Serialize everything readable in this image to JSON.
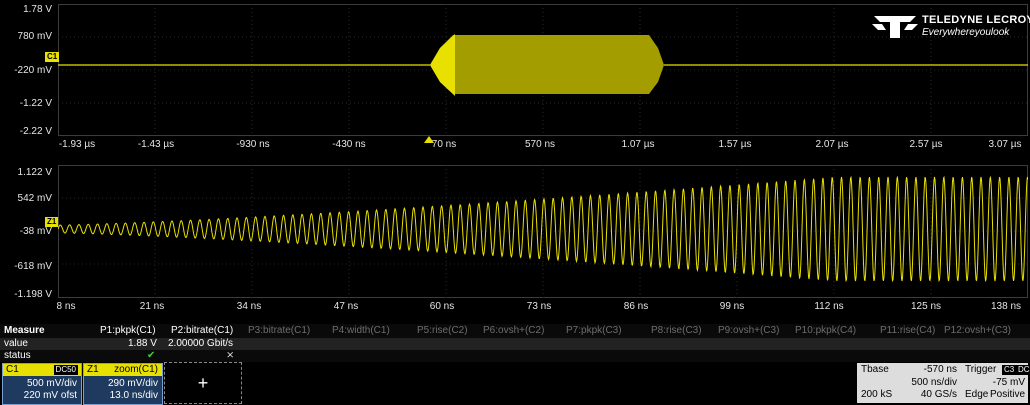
{
  "top_panel": {
    "y_labels": [
      "1.78 V",
      "780 mV",
      "-220 mV",
      "-1.22 V",
      "-2.22 V"
    ],
    "x_labels": [
      "-1.93 µs",
      "-1.43 µs",
      "-930 ns",
      "-430 ns",
      "70 ns",
      "570 ns",
      "1.07 µs",
      "1.57 µs",
      "2.07 µs",
      "2.57 µs",
      "3.07 µs"
    ],
    "channel_tag": "C1",
    "trace_color": "#e8e000"
  },
  "bottom_panel": {
    "y_labels": [
      "1.122 V",
      "542 mV",
      "-38 mV",
      "-618 mV",
      "-1.198 V"
    ],
    "x_labels": [
      "8 ns",
      "21 ns",
      "34 ns",
      "47 ns",
      "60 ns",
      "73 ns",
      "86 ns",
      "99 ns",
      "112 ns",
      "125 ns",
      "138 ns"
    ],
    "channel_tag": "Z1",
    "trace_color": "#e8e000"
  },
  "logo": {
    "name": "TELEDYNE LECROY",
    "tagline": "Everywhereyoulook"
  },
  "measure": {
    "title": "Measure",
    "row_labels": [
      "value",
      "status"
    ],
    "params": [
      {
        "name": "P1:pkpk(C1)",
        "value": "1.88 V",
        "status": "✔",
        "active": true
      },
      {
        "name": "P2:bitrate(C1)",
        "value": "2.00000 Gbit/s",
        "status": "⨯",
        "active": true
      },
      {
        "name": "P3:bitrate(C1)",
        "value": "",
        "status": "",
        "active": false
      },
      {
        "name": "P4:width(C1)",
        "value": "",
        "status": "",
        "active": false
      },
      {
        "name": "P5:rise(C2)",
        "value": "",
        "status": "",
        "active": false
      },
      {
        "name": "P6:ovsh+(C2)",
        "value": "",
        "status": "",
        "active": false
      },
      {
        "name": "P7:pkpk(C3)",
        "value": "",
        "status": "",
        "active": false
      },
      {
        "name": "P8:rise(C3)",
        "value": "",
        "status": "",
        "active": false
      },
      {
        "name": "P9:ovsh+(C3)",
        "value": "",
        "status": "",
        "active": false
      },
      {
        "name": "P10:pkpk(C4)",
        "value": "",
        "status": "",
        "active": false
      },
      {
        "name": "P11:rise(C4)",
        "value": "",
        "status": "",
        "active": false
      },
      {
        "name": "P12:ovsh+(C3)",
        "value": "",
        "status": "",
        "active": false
      }
    ]
  },
  "c1_desc": {
    "label": "C1",
    "badge": "DC50",
    "line1": "500 mV/div",
    "line2": "220 mV ofst"
  },
  "z1_desc": {
    "label": "Z1",
    "title": "zoom(C1)",
    "line1": "290 mV/div",
    "line2": "13.0 ns/div"
  },
  "add_button": {
    "label": "+"
  },
  "timebase": {
    "tbase_label": "Tbase",
    "tbase_value": "-570 ns",
    "trigger_label": "Trigger",
    "trigger_badge1": "C3",
    "trigger_badge2": "DC",
    "line2_left": "500 ns/div",
    "line2_right": "-75 mV",
    "line3_a": "200 kS",
    "line3_b": "40 GS/s",
    "line3_c": "Edge",
    "line3_d": "Positive"
  }
}
